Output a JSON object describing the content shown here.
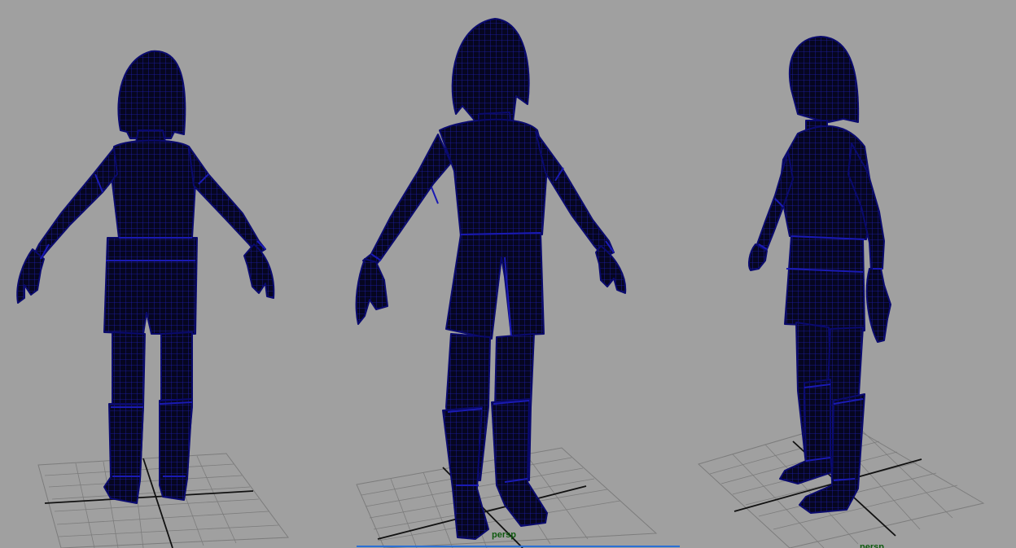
{
  "viewports": [
    {
      "id": "back",
      "camera_label": ""
    },
    {
      "id": "front",
      "camera_label": "persp",
      "active": true
    },
    {
      "id": "side",
      "camera_label": "persp"
    }
  ],
  "colors": {
    "background": "#a0a0a0",
    "mesh_fill": "#060620",
    "wireframe": "#1a1ab4",
    "grid": "#7c7c7c",
    "axis": "#111111",
    "camera_label": "#0f5a0f",
    "active_highlight": "#2b6fd6"
  }
}
